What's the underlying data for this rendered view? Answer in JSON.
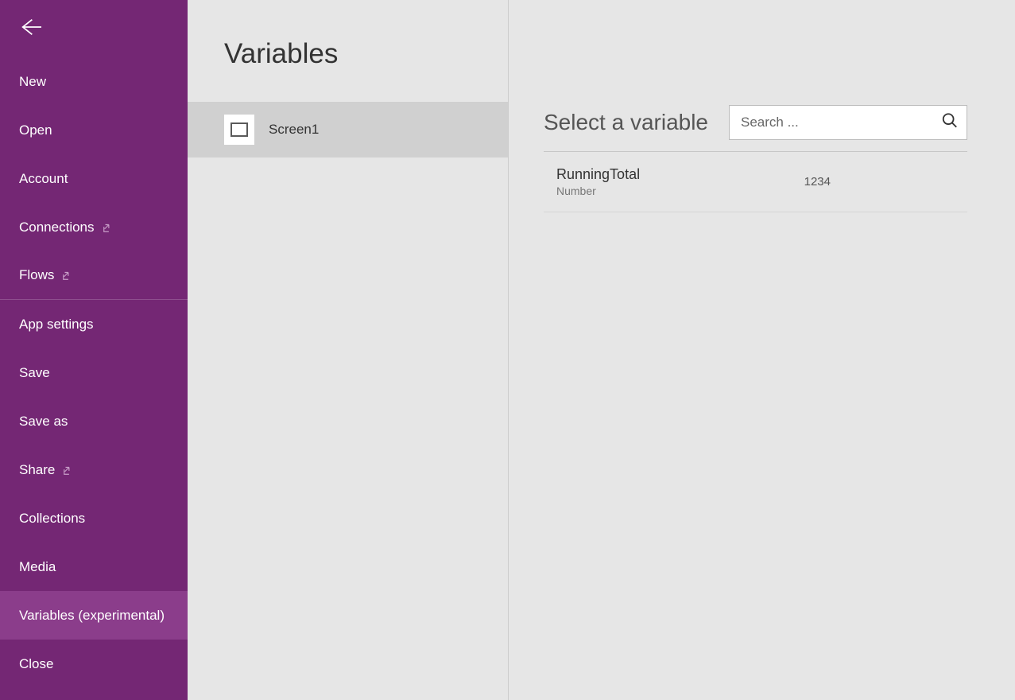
{
  "sidebar": {
    "items": {
      "new": "New",
      "open": "Open",
      "account": "Account",
      "connections": "Connections",
      "flows": "Flows",
      "appSettings": "App settings",
      "save": "Save",
      "saveAs": "Save as",
      "share": "Share",
      "collections": "Collections",
      "media": "Media",
      "variables": "Variables (experimental)",
      "close": "Close"
    }
  },
  "middle": {
    "title": "Variables",
    "screen": "Screen1"
  },
  "right": {
    "title": "Select a variable",
    "searchPlaceholder": "Search ...",
    "variable": {
      "name": "RunningTotal",
      "type": "Number",
      "value": "1234"
    }
  }
}
